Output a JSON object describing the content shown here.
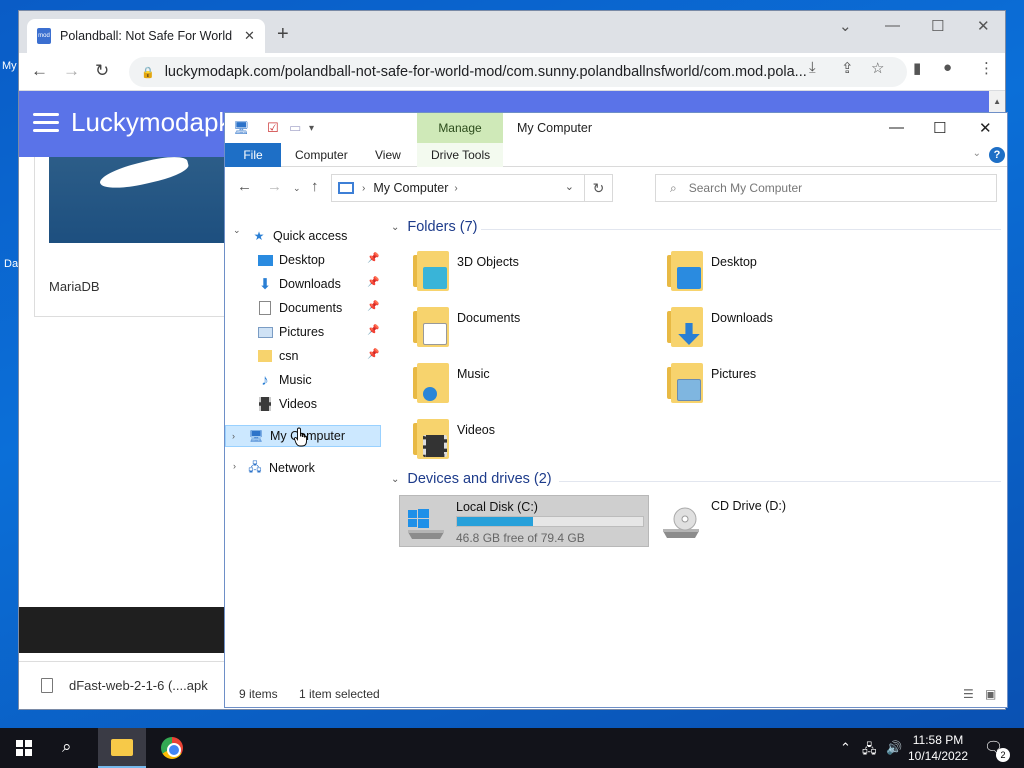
{
  "desktop": {
    "label_1": "My",
    "label_2": "Da"
  },
  "browser": {
    "tab_title": "Polandball: Not Safe For World M",
    "tab_favicon_text": "mod",
    "url": "luckymodapk.com/polandball-not-safe-for-world-mod/com.sunny.polandballnsfworld/com.mod.pola...",
    "site_title": "Luckymodapk",
    "card_label": "MariaDB",
    "download_name": "dFast-web-2-1-6 (....apk"
  },
  "explorer": {
    "manage_tab": "Manage",
    "window_title": "My Computer",
    "ribbon_tabs": {
      "file": "File",
      "computer": "Computer",
      "view": "View",
      "drive_tools": "Drive Tools"
    },
    "address": {
      "location": "My Computer"
    },
    "search": {
      "placeholder": "Search My Computer"
    },
    "nav": {
      "quick_access": "Quick access",
      "items": [
        {
          "label": "Desktop",
          "icon": "desktop-icon"
        },
        {
          "label": "Downloads",
          "icon": "downloads-icon"
        },
        {
          "label": "Documents",
          "icon": "documents-icon"
        },
        {
          "label": "Pictures",
          "icon": "pictures-icon"
        },
        {
          "label": "csn",
          "icon": "folder-icon"
        },
        {
          "label": "Music",
          "icon": "music-icon"
        },
        {
          "label": "Videos",
          "icon": "videos-icon"
        }
      ],
      "my_computer": "My Computer",
      "network": "Network"
    },
    "folders_header": "Folders (7)",
    "folders": [
      {
        "name": "3D Objects",
        "overlay_color": "#39b4d8"
      },
      {
        "name": "Desktop",
        "overlay_color": "#2a8be0"
      },
      {
        "name": "Documents",
        "overlay_color": "#ffffff"
      },
      {
        "name": "Downloads",
        "overlay_color": "#2a7fd4"
      },
      {
        "name": "Music",
        "overlay_color": "#2a86d8"
      },
      {
        "name": "Pictures",
        "overlay_color": "#7fb6e0"
      },
      {
        "name": "Videos",
        "overlay_color": "#333333"
      }
    ],
    "devices_header": "Devices and drives (2)",
    "drives": [
      {
        "name": "Local Disk (C:)",
        "free_text": "46.8 GB free of 79.4 GB",
        "used_fraction": 0.41
      },
      {
        "name": "CD Drive (D:)"
      }
    ],
    "status": {
      "items": "9 items",
      "selected": "1 item selected"
    }
  },
  "taskbar": {
    "time": "11:58 PM",
    "date": "10/14/2022",
    "notification_count": "2",
    "accent": "#76b9ed"
  }
}
